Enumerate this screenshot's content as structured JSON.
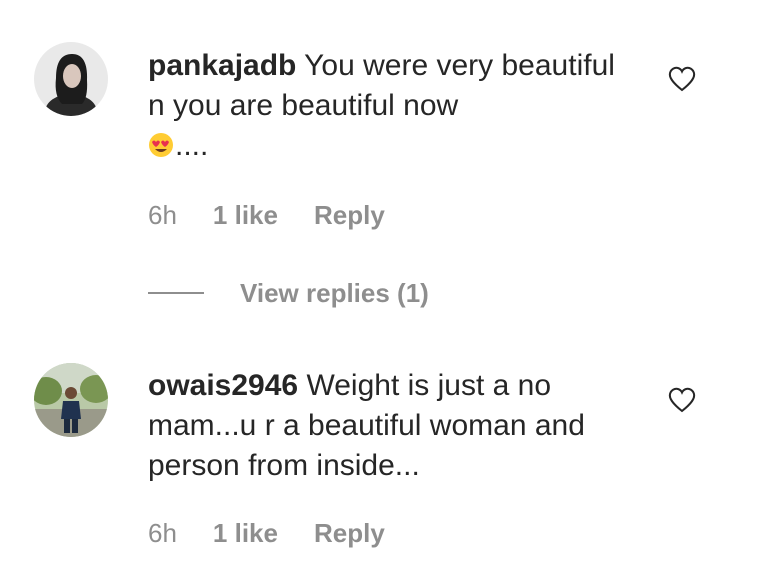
{
  "comments": [
    {
      "username": "pankajadb",
      "text": "You were very beautiful n you are beautiful now",
      "emoji_trailing": "....",
      "time": "6h",
      "likes": "1 like",
      "reply_label": "Reply",
      "view_replies": "View replies (1)",
      "emoji_icon": "heart-eyes-emoji-icon"
    },
    {
      "username": "owais2946",
      "text": "Weight is just a no mam...u r a beautiful woman and person from inside...",
      "time": "6h",
      "likes": "1 like",
      "reply_label": "Reply"
    }
  ],
  "colors": {
    "text": "#262626",
    "secondary": "#8e8e8e"
  }
}
